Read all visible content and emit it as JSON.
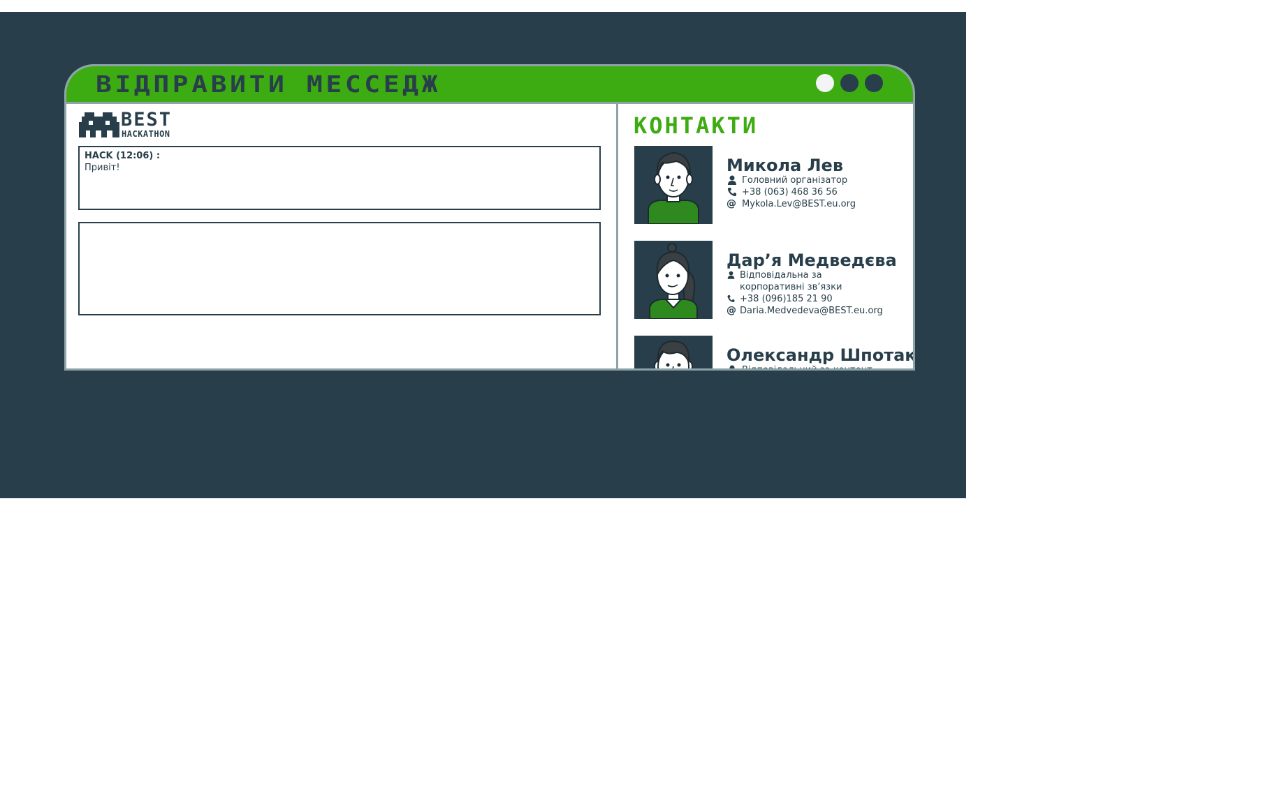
{
  "window": {
    "title": "Відправити месседж"
  },
  "logo": {
    "best": "BEST",
    "hackathon": "HACKATHON"
  },
  "chat": {
    "messages": [
      {
        "author": "HACK (12:06) :",
        "text": "Привіт!"
      }
    ],
    "input_value": ""
  },
  "contacts": {
    "title": "Контакти",
    "items": [
      {
        "name": "Микола Лев",
        "role": "Головний організатор",
        "phone": "+38 (063) 468 36 56",
        "email": "Mykola.Lev@BEST.eu.org"
      },
      {
        "name": "Дар’я Медведєва",
        "role_line1": "Відповідальна за",
        "role_line2": "корпоративні зв’язки",
        "phone": "+38 (096)185 21 90",
        "email": "Daria.Medvedeva@BEST.eu.org"
      },
      {
        "name": "Олександр Шпотак",
        "role": "Відповідальний за контент"
      }
    ]
  },
  "colors": {
    "accent": "#3dab12",
    "dark": "#283f4b",
    "border": "#8fa3aa"
  }
}
